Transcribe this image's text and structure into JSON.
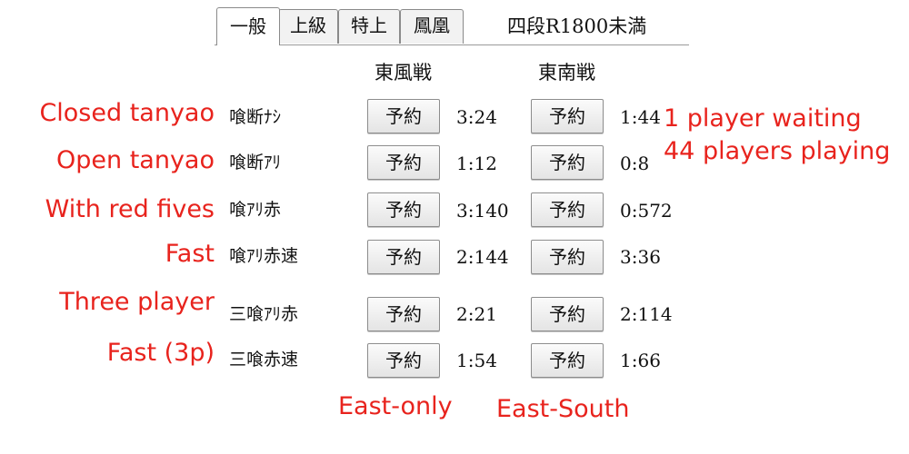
{
  "tabs": [
    {
      "label": "一般",
      "active": true
    },
    {
      "label": "上級",
      "active": false
    },
    {
      "label": "特上",
      "active": false
    },
    {
      "label": "鳳凰",
      "active": false
    }
  ],
  "tab_note": "四段R1800未満",
  "columns": {
    "east_only": "東風戦",
    "east_south": "東南戦"
  },
  "reserve_label": "予約",
  "rows": [
    {
      "rule": "喰断ﾅｼ",
      "annotation": "Closed tanyao",
      "east_only_count": "3:24",
      "east_south_count": "1:44"
    },
    {
      "rule": "喰断ｱﾘ",
      "annotation": "Open tanyao",
      "east_only_count": "1:12",
      "east_south_count": "0:8"
    },
    {
      "rule": "喰ｱﾘ赤",
      "annotation": "With red fives",
      "east_only_count": "3:140",
      "east_south_count": "0:572"
    },
    {
      "rule": "喰ｱﾘ赤速",
      "annotation": "Fast",
      "east_only_count": "2:144",
      "east_south_count": "3:36"
    },
    {
      "rule": "三喰ｱﾘ赤",
      "annotation": "Three player",
      "east_only_count": "2:21",
      "east_south_count": "2:114"
    },
    {
      "rule": "三喰赤速",
      "annotation": "Fast (3p)",
      "east_only_count": "1:54",
      "east_south_count": "1:66"
    }
  ],
  "legend": {
    "waiting": "1 player waiting",
    "playing": "44 players playing"
  },
  "column_annotations": {
    "east_only": "East-only",
    "east_south": "East-South"
  },
  "colors": {
    "annotation": "#e8231d",
    "text": "#111111"
  }
}
